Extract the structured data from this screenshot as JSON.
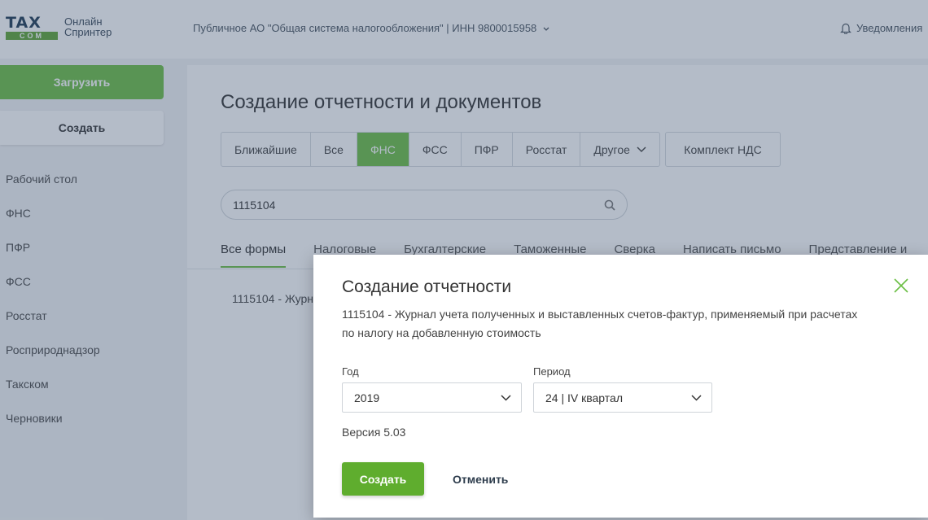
{
  "header": {
    "logo_top": "TAX",
    "logo_bottom": "COM",
    "logo_text_line1": "Онлайн",
    "logo_text_line2": "Спринтер",
    "organization": "Публичное АО \"Общая система налогообложения\" | ИНН 9800015958",
    "notifications_label": "Уведомления"
  },
  "sidebar": {
    "upload_label": "Загрузить",
    "create_label": "Создать",
    "items": [
      {
        "label": "Рабочий стол"
      },
      {
        "label": "ФНС"
      },
      {
        "label": "ПФР"
      },
      {
        "label": "ФСС"
      },
      {
        "label": "Росстат"
      },
      {
        "label": "Росприроднадзор"
      },
      {
        "label": "Такском"
      },
      {
        "label": "Черновики"
      }
    ]
  },
  "main": {
    "title": "Создание отчетности и документов",
    "filters": [
      {
        "label": "Ближайшие",
        "active": false
      },
      {
        "label": "Все",
        "active": false
      },
      {
        "label": "ФНС",
        "active": true
      },
      {
        "label": "ФСС",
        "active": false
      },
      {
        "label": "ПФР",
        "active": false
      },
      {
        "label": "Росстат",
        "active": false
      },
      {
        "label": "Другое",
        "active": false
      }
    ],
    "nds_button": "Комплект НДС",
    "search": {
      "value": "1115104"
    },
    "tabs": [
      {
        "label": "Все формы",
        "active": true
      },
      {
        "label": "Налоговые",
        "active": false
      },
      {
        "label": "Бухгалтерские",
        "active": false
      },
      {
        "label": "Таможенные",
        "active": false
      },
      {
        "label": "Сверка",
        "active": false
      },
      {
        "label": "Написать письмо",
        "active": false
      },
      {
        "label": "Представление и",
        "active": false
      }
    ],
    "result_row": "1115104 - Журн"
  },
  "modal": {
    "title": "Создание отчетности",
    "description": "1115104 - Журнал учета полученных и выставленных счетов-фактур, применяемый при расчетах по налогу на добавленную стоимость",
    "year_label": "Год",
    "year_value": "2019",
    "period_label": "Период",
    "period_value": "24 | IV квартал",
    "version": "Версия 5.03",
    "create_label": "Создать",
    "cancel_label": "Отменить"
  },
  "colors": {
    "accent_green": "#6cbf45",
    "button_green": "#5fad2e",
    "overlay": "#3a506e"
  }
}
